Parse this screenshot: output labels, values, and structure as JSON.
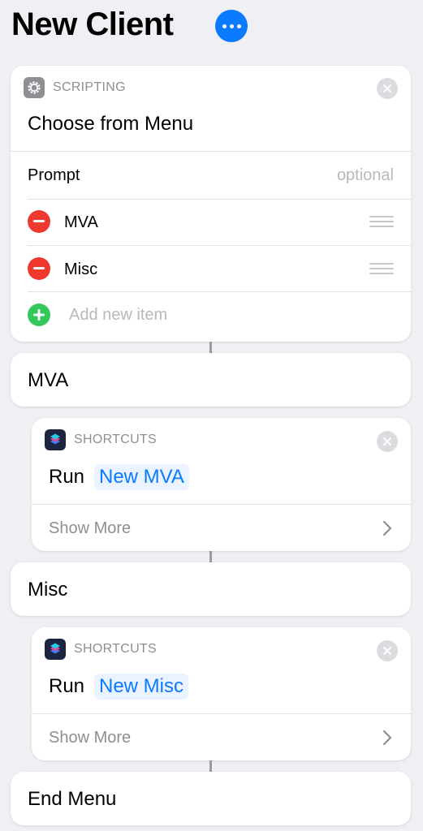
{
  "header": {
    "title": "New Client"
  },
  "menu_action": {
    "category": "SCRIPTING",
    "title": "Choose from Menu",
    "prompt_label": "Prompt",
    "prompt_placeholder": "optional",
    "items": [
      "MVA",
      "Misc"
    ],
    "add_item": "Add new item"
  },
  "sections": [
    {
      "label": "MVA"
    },
    {
      "label": "Misc"
    },
    {
      "label": "End Menu"
    }
  ],
  "run_actions": [
    {
      "category": "SHORTCUTS",
      "verb": "Run",
      "target": "New MVA",
      "show_more": "Show More"
    },
    {
      "category": "SHORTCUTS",
      "verb": "Run",
      "target": "New Misc",
      "show_more": "Show More"
    }
  ],
  "colors": {
    "accent": "#0a7aff",
    "remove": "#f0392e",
    "add": "#34c759",
    "background": "#efeff4"
  }
}
